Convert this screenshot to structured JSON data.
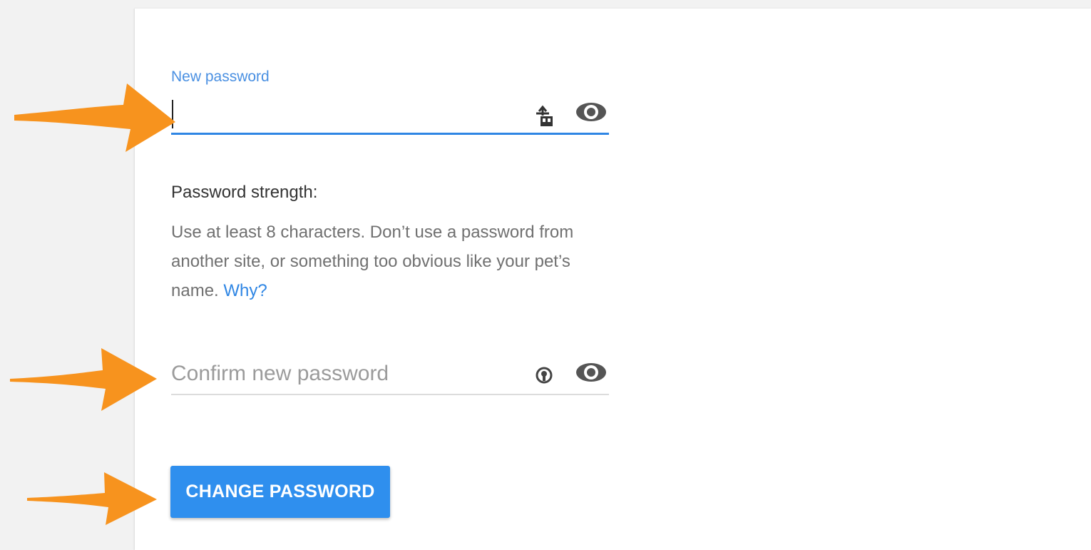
{
  "form": {
    "new_password_label": "New password",
    "new_password_value": "",
    "confirm_password_placeholder": "Confirm new password",
    "confirm_password_value": "",
    "strength_heading": "Password strength:",
    "help_text": "Use at least 8 characters. Don’t use a password from another site, or something too obvious like your pet’s name.",
    "help_link": "Why?",
    "submit_label": "CHANGE PASSWORD"
  },
  "icons": {
    "new_password_extension": "password-manager-key-icon",
    "new_password_toggle": "eye-icon",
    "confirm_password_extension": "password-generator-icon",
    "confirm_password_toggle": "eye-icon"
  },
  "colors": {
    "accent": "#2f86e4",
    "button": "#2f8fee",
    "arrow": "#f7931e",
    "background": "#f2f2f2",
    "card": "#ffffff"
  }
}
